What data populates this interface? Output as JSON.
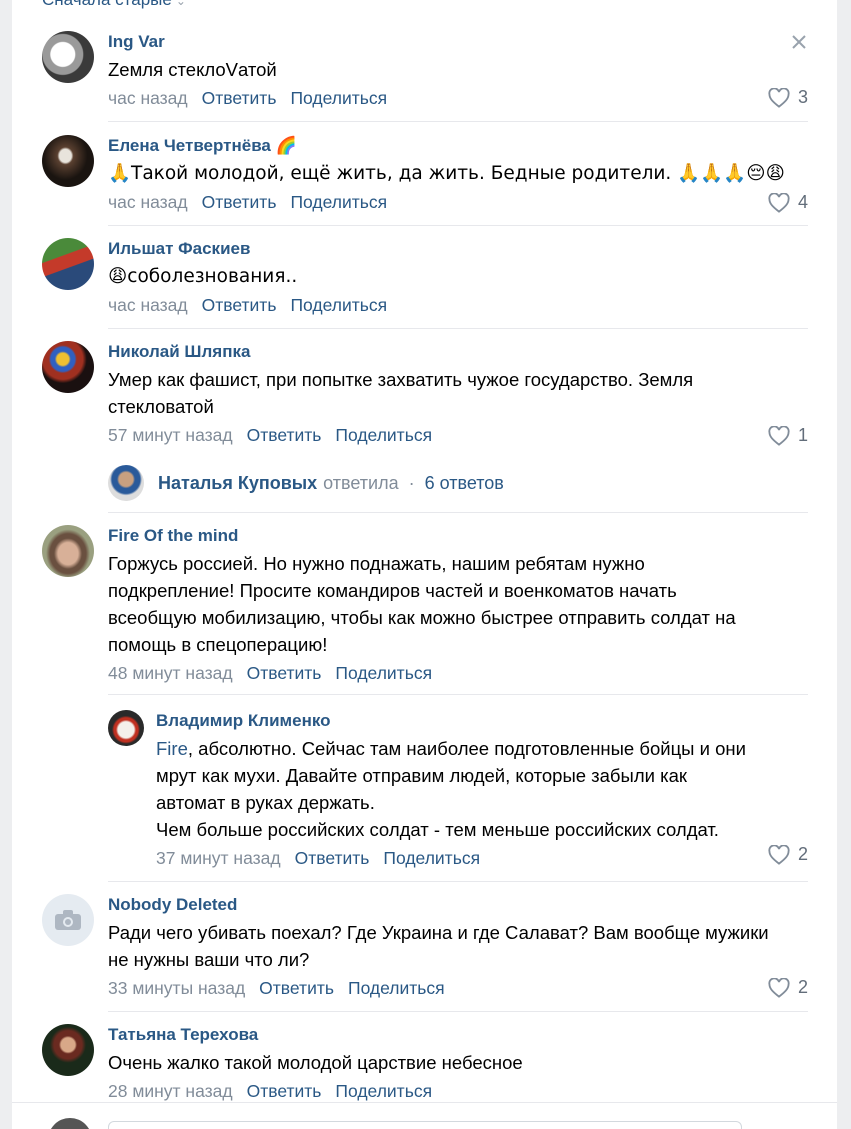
{
  "sort_label": "Сначала старые",
  "comments": [
    {
      "author": "Ing Var",
      "text": "Zемля стеклоVатой",
      "time": "час назад",
      "reply": "Ответить",
      "share": "Поделиться",
      "likes": "3"
    },
    {
      "author": "Елена Четвертнёва 🌈",
      "text": "🙏Такой молодой, ещё жить, да жить. Бедные родители. 🙏🙏🙏😔😩",
      "time": "час назад",
      "reply": "Ответить",
      "share": "Поделиться",
      "likes": "4"
    },
    {
      "author": "Ильшат Фаскиев",
      "text": "😩соболезнования..",
      "time": "час назад",
      "reply": "Ответить",
      "share": "Поделиться"
    },
    {
      "author": "Николай Шляпка",
      "text_line1": "Умер как фашист, при попытке захватить чужое государство. Земля",
      "text_line2": "стекловатой",
      "time": "57 минут назад",
      "reply": "Ответить",
      "share": "Поделиться",
      "likes": "1",
      "replies": {
        "name": "Наталья Куповых",
        "verb": "ответила",
        "count": "6 ответов"
      }
    },
    {
      "author": "Fire Of the mind",
      "text_lines": [
        "Горжусь россией. Но нужно поднажать, нашим ребятам нужно",
        "подкрепление! Просите командиров частей и военкоматов начать",
        "всеобщую мобилизацию, чтобы как можно быстрее отправить солдат на",
        "помощь в спецоперацию!"
      ],
      "time": "48 минут назад",
      "reply": "Ответить",
      "share": "Поделиться"
    },
    {
      "author": "Владимир Клименко",
      "mention": "Fire",
      "text_first": ", абсолютно. Сейчас там наиболее подготовленные бойцы и они",
      "text_lines": [
        "мрут как мухи. Давайте отправим людей, которые забыли как",
        "автомат в руках держать.",
        "Чем больше российских солдат - тем меньше российских солдат."
      ],
      "time": "37 минут назад",
      "reply": "Ответить",
      "share": "Поделиться",
      "likes": "2"
    },
    {
      "author": "Nobody Deleted",
      "text_lines": [
        "Ради чего убивать поехал? Где Украина и где Салават? Вам вообще мужики",
        "не нужны ваши что ли?"
      ],
      "time": "33 минуты назад",
      "reply": "Ответить",
      "share": "Поделиться",
      "likes": "2"
    },
    {
      "author": "Татьяна Терехова",
      "text": "Очень жалко такой молодой царствие небесное",
      "time": "28 минут назад",
      "reply": "Ответить",
      "share": "Поделиться"
    }
  ],
  "colors": {
    "link": "#2a5885",
    "meta": "#818c99",
    "like_icon": "#99a2ad",
    "separator": "#e7e8ec"
  }
}
